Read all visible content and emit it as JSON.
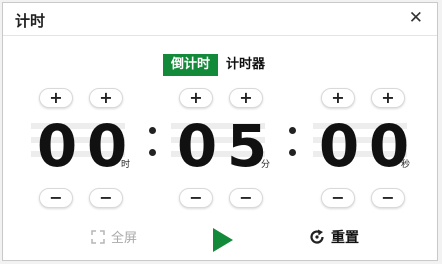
{
  "window": {
    "title": "计时"
  },
  "tabs": [
    {
      "label": "倒计时",
      "active": true
    },
    {
      "label": "计时器",
      "active": false
    }
  ],
  "timer": {
    "hours": {
      "d1": "0",
      "d2": "0",
      "unit": "时"
    },
    "minutes": {
      "d1": "0",
      "d2": "5",
      "unit": "分"
    },
    "seconds": {
      "d1": "0",
      "d2": "0",
      "unit": "秒"
    }
  },
  "controls": {
    "plus_glyph": "+",
    "minus_glyph": "−"
  },
  "footer": {
    "fullscreen_label": "全屏",
    "reset_label": "重置"
  },
  "colors": {
    "accent": "#138a3a",
    "text": "#111111",
    "muted": "#aaaaaa"
  },
  "icons": [
    "close-icon",
    "fullscreen-icon",
    "play-icon",
    "reset-icon"
  ]
}
